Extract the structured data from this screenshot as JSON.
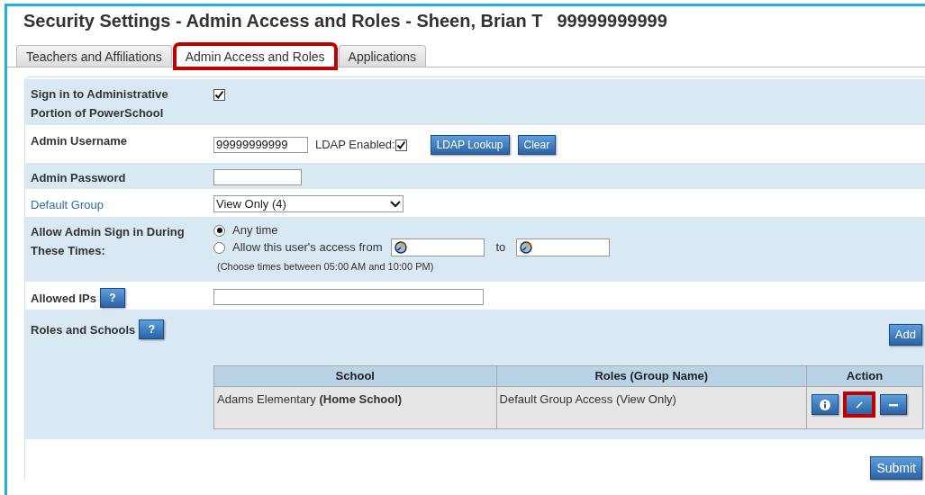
{
  "title": {
    "text": "Security Settings - Admin Access and Roles - Sheen, Brian T",
    "id_number": "99999999999"
  },
  "tabs": [
    {
      "label": "Teachers and Affiliations",
      "selected": false,
      "highlighted": false
    },
    {
      "label": "Admin Access and Roles",
      "selected": true,
      "highlighted": true
    },
    {
      "label": "Applications",
      "selected": false,
      "highlighted": false
    }
  ],
  "sign_in": {
    "label": "Sign in to Administrative Portion of PowerSchool",
    "checked": true
  },
  "admin_username": {
    "label": "Admin Username",
    "value": "99999999999",
    "ldap_label": "LDAP Enabled:",
    "ldap_checked": true,
    "buttons": [
      "LDAP Lookup",
      "Clear"
    ]
  },
  "admin_password": {
    "label": "Admin Password"
  },
  "default_group": {
    "label": "Default Group",
    "value": "View Only (4)"
  },
  "sign_in_times": {
    "label": "Allow Admin Sign in During These Times:",
    "options": [
      {
        "label": "Any time",
        "selected": true
      },
      {
        "label": "Allow this user's access from",
        "selected": false
      }
    ],
    "to_label": "to",
    "hint": "(Choose times between 05:00 AM and 10:00 PM)"
  },
  "allowed_ips": {
    "label": "Allowed IPs",
    "help": "?"
  },
  "roles": {
    "label": "Roles and Schools",
    "help": "?",
    "add_button": "Add",
    "columns": [
      "School",
      "Roles (Group Name)",
      "Action"
    ],
    "rows": [
      {
        "school": "Adams Elementary **(Home School)**",
        "roles": "Default Group Access (View Only)",
        "actions": [
          {
            "kind": "info",
            "highlighted": false
          },
          {
            "kind": "edit",
            "highlighted": true
          },
          {
            "kind": "remove",
            "highlighted": false
          }
        ]
      }
    ]
  },
  "submit_button": "Submit"
}
